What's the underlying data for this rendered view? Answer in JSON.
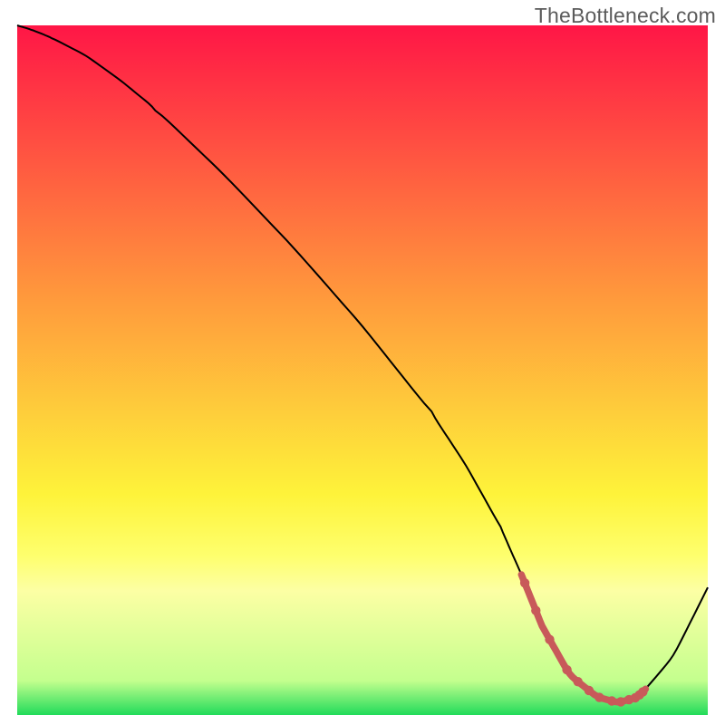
{
  "watermark": "TheBottleneck.com",
  "chart_data": {
    "type": "line",
    "title": "",
    "xlabel": "",
    "ylabel": "",
    "xlim": [
      0,
      100
    ],
    "ylim": [
      0,
      100
    ],
    "grid": false,
    "legend": false,
    "background_gradient": {
      "stops": [
        {
          "offset": 0.0,
          "color": "#ff1646"
        },
        {
          "offset": 0.4,
          "color": "#ff9b3c"
        },
        {
          "offset": 0.68,
          "color": "#fef33a"
        },
        {
          "offset": 0.77,
          "color": "#feff6e"
        },
        {
          "offset": 0.82,
          "color": "#fcffa4"
        },
        {
          "offset": 0.95,
          "color": "#c4ff8e"
        },
        {
          "offset": 1.0,
          "color": "#21db5a"
        }
      ]
    },
    "series": [
      {
        "name": "bottleneck-curve",
        "x": [
          0,
          2,
          5,
          10,
          15,
          20,
          30,
          40,
          50,
          60,
          65,
          70,
          73,
          76,
          80,
          84,
          87,
          90,
          95,
          100
        ],
        "y": [
          100,
          99.4,
          98.2,
          95.6,
          92.0,
          87.9,
          78.3,
          67.8,
          56.4,
          43.8,
          36.2,
          27.2,
          20.4,
          12.9,
          5.8,
          2.6,
          1.8,
          2.6,
          8.5,
          18.5
        ]
      }
    ],
    "highlight_range_x": [
      73,
      91
    ],
    "highlight_markers_x": [
      73.5,
      75.1,
      77.1,
      79.6,
      81.2,
      82.8,
      84.3,
      86.1,
      87.4,
      88.6,
      89.5,
      90.1,
      90.6
    ]
  }
}
